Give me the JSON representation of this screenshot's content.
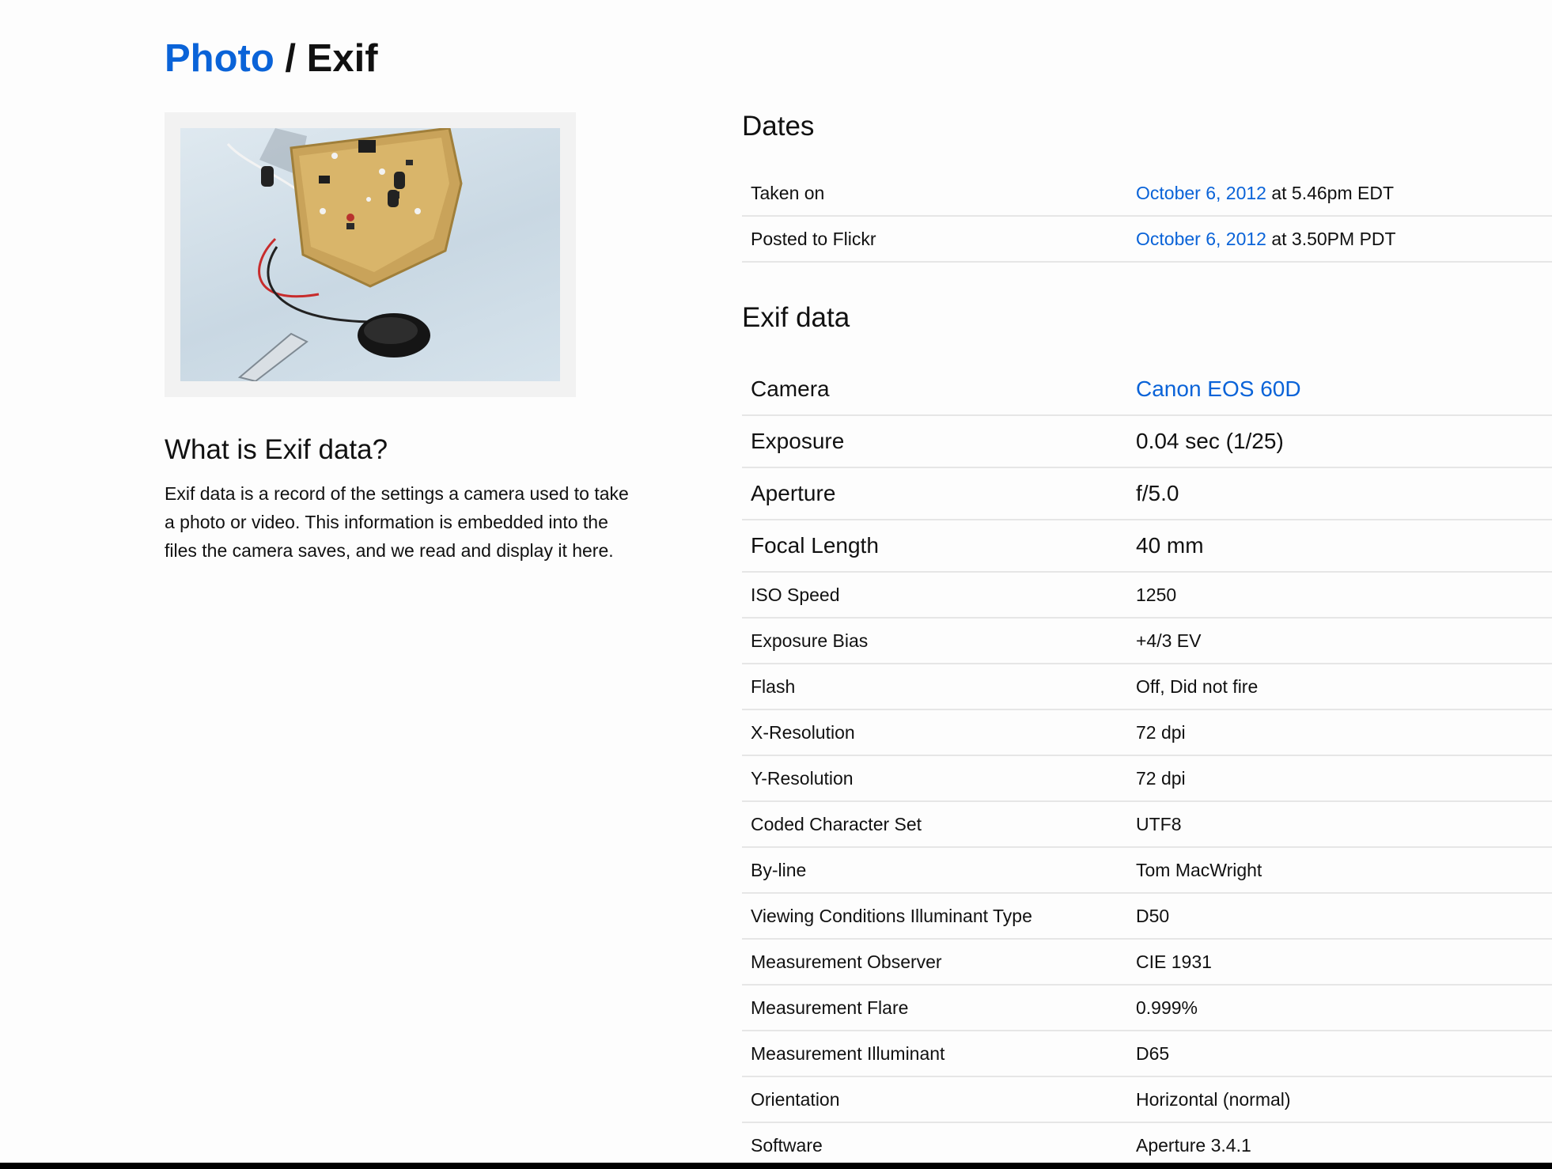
{
  "header": {
    "breadcrumb_link": "Photo",
    "separator": " / ",
    "title": "Exif"
  },
  "about": {
    "title": "What is Exif data?",
    "text": "Exif data is a record of the settings a camera used to take a photo or video. This information is embedded into the files the camera saves, and we read and display it here."
  },
  "dates": {
    "title": "Dates",
    "rows": [
      {
        "label": "Taken on",
        "date_link": "October 6, 2012",
        "time": " at 5.46pm EDT"
      },
      {
        "label": "Posted to Flickr",
        "date_link": "October 6, 2012",
        "time": " at 3.50PM PDT"
      }
    ]
  },
  "exif": {
    "title": "Exif data",
    "camera": {
      "label": "Camera",
      "value": "Canon EOS 60D"
    },
    "rows": [
      {
        "label": "Exposure",
        "value": "0.04 sec (1/25)"
      },
      {
        "label": "Aperture",
        "value": "f/5.0"
      },
      {
        "label": "Focal Length",
        "value": "40 mm"
      },
      {
        "label": "ISO Speed",
        "value": "1250"
      },
      {
        "label": "Exposure Bias",
        "value": "+4/3 EV"
      },
      {
        "label": "Flash",
        "value": "Off, Did not fire"
      },
      {
        "label": "X-Resolution",
        "value": "72 dpi"
      },
      {
        "label": "Y-Resolution",
        "value": "72 dpi"
      },
      {
        "label": "Coded Character Set",
        "value": "UTF8"
      },
      {
        "label": "By-line",
        "value": "Tom MacWright"
      },
      {
        "label": "Viewing Conditions Illuminant Type",
        "value": "D50"
      },
      {
        "label": "Measurement Observer",
        "value": "CIE 1931"
      },
      {
        "label": "Measurement Flare",
        "value": "0.999%"
      },
      {
        "label": "Measurement Illuminant",
        "value": "D65"
      },
      {
        "label": "Orientation",
        "value": "Horizontal (normal)"
      },
      {
        "label": "Software",
        "value": "Aperture 3.4.1"
      }
    ]
  },
  "colors": {
    "link": "#0a63d8",
    "divider": "#e6e6e6",
    "text": "#111111"
  }
}
